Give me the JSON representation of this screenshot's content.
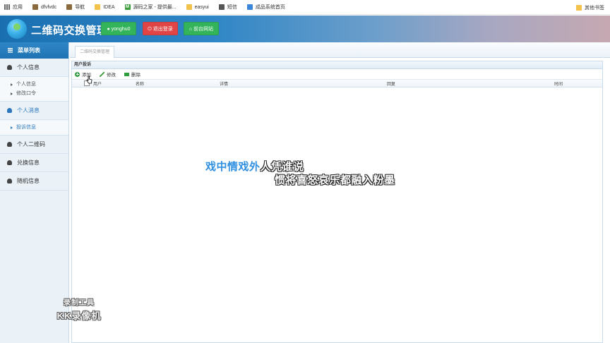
{
  "bookmarks": [
    {
      "label": "应用",
      "icon": "apps-icon"
    },
    {
      "label": "dfvfvdc",
      "icon": "image-icon"
    },
    {
      "label": "导航",
      "icon": "image-icon"
    },
    {
      "label": "IDEA",
      "icon": "folder-icon"
    },
    {
      "label": "源码之家 - 提供最...",
      "icon": "m-icon"
    },
    {
      "label": "easyui",
      "icon": "folder-icon"
    },
    {
      "label": "短信",
      "icon": "globe-icon"
    },
    {
      "label": "成品系统首页",
      "icon": "blue-globe-icon"
    }
  ],
  "bookmarks_other": "其他书签",
  "header": {
    "title": "二维码交换管理",
    "user_button": "yonghu0",
    "logout_button": "退出登录",
    "front_button": "前台网站"
  },
  "sidebar": {
    "menu_title": "菜单列表",
    "groups": [
      {
        "label": "个人信息",
        "items": [
          "个人信息",
          "修改口令"
        ]
      },
      {
        "label": "个人消息",
        "items": [
          "投诉信息"
        ]
      },
      {
        "label": "个人二维码",
        "items": []
      },
      {
        "label": "兑换信息",
        "items": []
      },
      {
        "label": "随机信息",
        "items": []
      }
    ]
  },
  "main": {
    "breadcrumb": "二维码交换管理",
    "panel_title": "用户投诉",
    "toolbar": {
      "add": "添加",
      "edit": "修改",
      "delete": "删除"
    },
    "columns": [
      "用户",
      "名称",
      "详情",
      "回复",
      "时间"
    ]
  },
  "overlay": {
    "subtitle_highlight": "戏中情戏外",
    "subtitle_rest": "人凭谁说",
    "subtitle_line2": "惯将喜怒哀乐都融入粉墨"
  },
  "watermark": {
    "line1": "录制工具",
    "line2": "KK录像机"
  },
  "colors": {
    "header_blue": "#1a6fb0",
    "accent_blue": "#2a77bd",
    "green_button": "#33b35a",
    "red_button": "#e04444"
  }
}
